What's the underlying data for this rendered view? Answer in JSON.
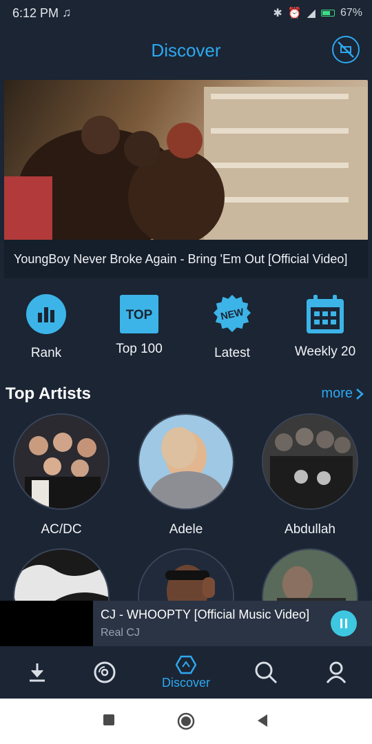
{
  "status": {
    "time": "6:12 PM",
    "battery_pct": "67%"
  },
  "header": {
    "title": "Discover",
    "ad_icon": "no-ads-icon"
  },
  "featured": {
    "caption": "YoungBoy Never Broke Again - Bring 'Em Out [Official Video]"
  },
  "quick_nav": [
    {
      "label": "Rank",
      "icon": "bar-chart-icon"
    },
    {
      "label": "Top 100",
      "icon": "top-badge-icon",
      "badge": "TOP"
    },
    {
      "label": "Latest",
      "icon": "new-badge-icon",
      "badge": "NEW"
    },
    {
      "label": "Weekly 20",
      "icon": "calendar-icon"
    }
  ],
  "top_artists": {
    "title": "Top Artists",
    "more": "more",
    "artists": [
      {
        "name": "AC/DC"
      },
      {
        "name": "Adele"
      },
      {
        "name": "Abdullah"
      }
    ]
  },
  "mini_player": {
    "title": "CJ - WHOOPTY [Official Music Video]",
    "artist": "Real CJ"
  },
  "tabs": [
    {
      "label": "",
      "icon": "download-icon"
    },
    {
      "label": "",
      "icon": "disc-icon"
    },
    {
      "label": "Discover",
      "icon": "discover-icon"
    },
    {
      "label": "",
      "icon": "search-icon"
    },
    {
      "label": "",
      "icon": "profile-icon"
    }
  ],
  "colors": {
    "accent": "#2ea8f0",
    "background": "#1b2534",
    "player": "#2a3444",
    "pause_button": "#3ec7e0"
  }
}
